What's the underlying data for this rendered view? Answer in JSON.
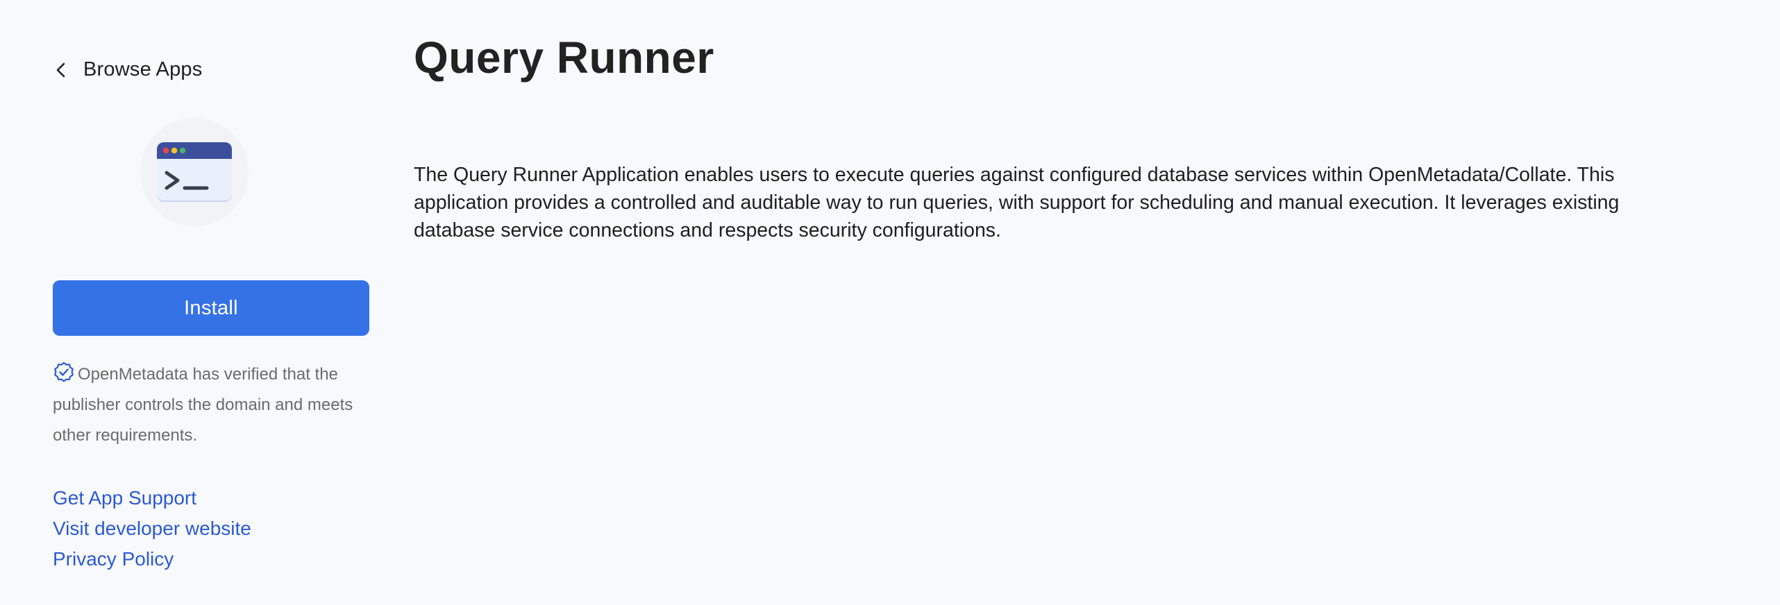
{
  "sidebar": {
    "back_label": "Browse Apps",
    "install_label": "Install",
    "verified_text": "OpenMetadata has verified that the publisher controls the domain and meets other requirements.",
    "links": [
      "Get App Support",
      "Visit developer website",
      "Privacy Policy"
    ]
  },
  "main": {
    "title": "Query Runner",
    "description": "The Query Runner Application enables users to execute queries against configured database services within OpenMetadata/Collate. This application provides a controlled and auditable way to run queries, with support for scheduling and manual execution. It leverages existing database service connections and respects security configurations."
  },
  "colors": {
    "background": "#f8f9fc",
    "primary": "#3572e6",
    "link": "#2b5ad1",
    "muted_text": "#6b6b6b"
  },
  "icons": {
    "back": "chevron-left-icon",
    "app_logo": "terminal-window-icon",
    "verified": "verified-badge-icon"
  }
}
